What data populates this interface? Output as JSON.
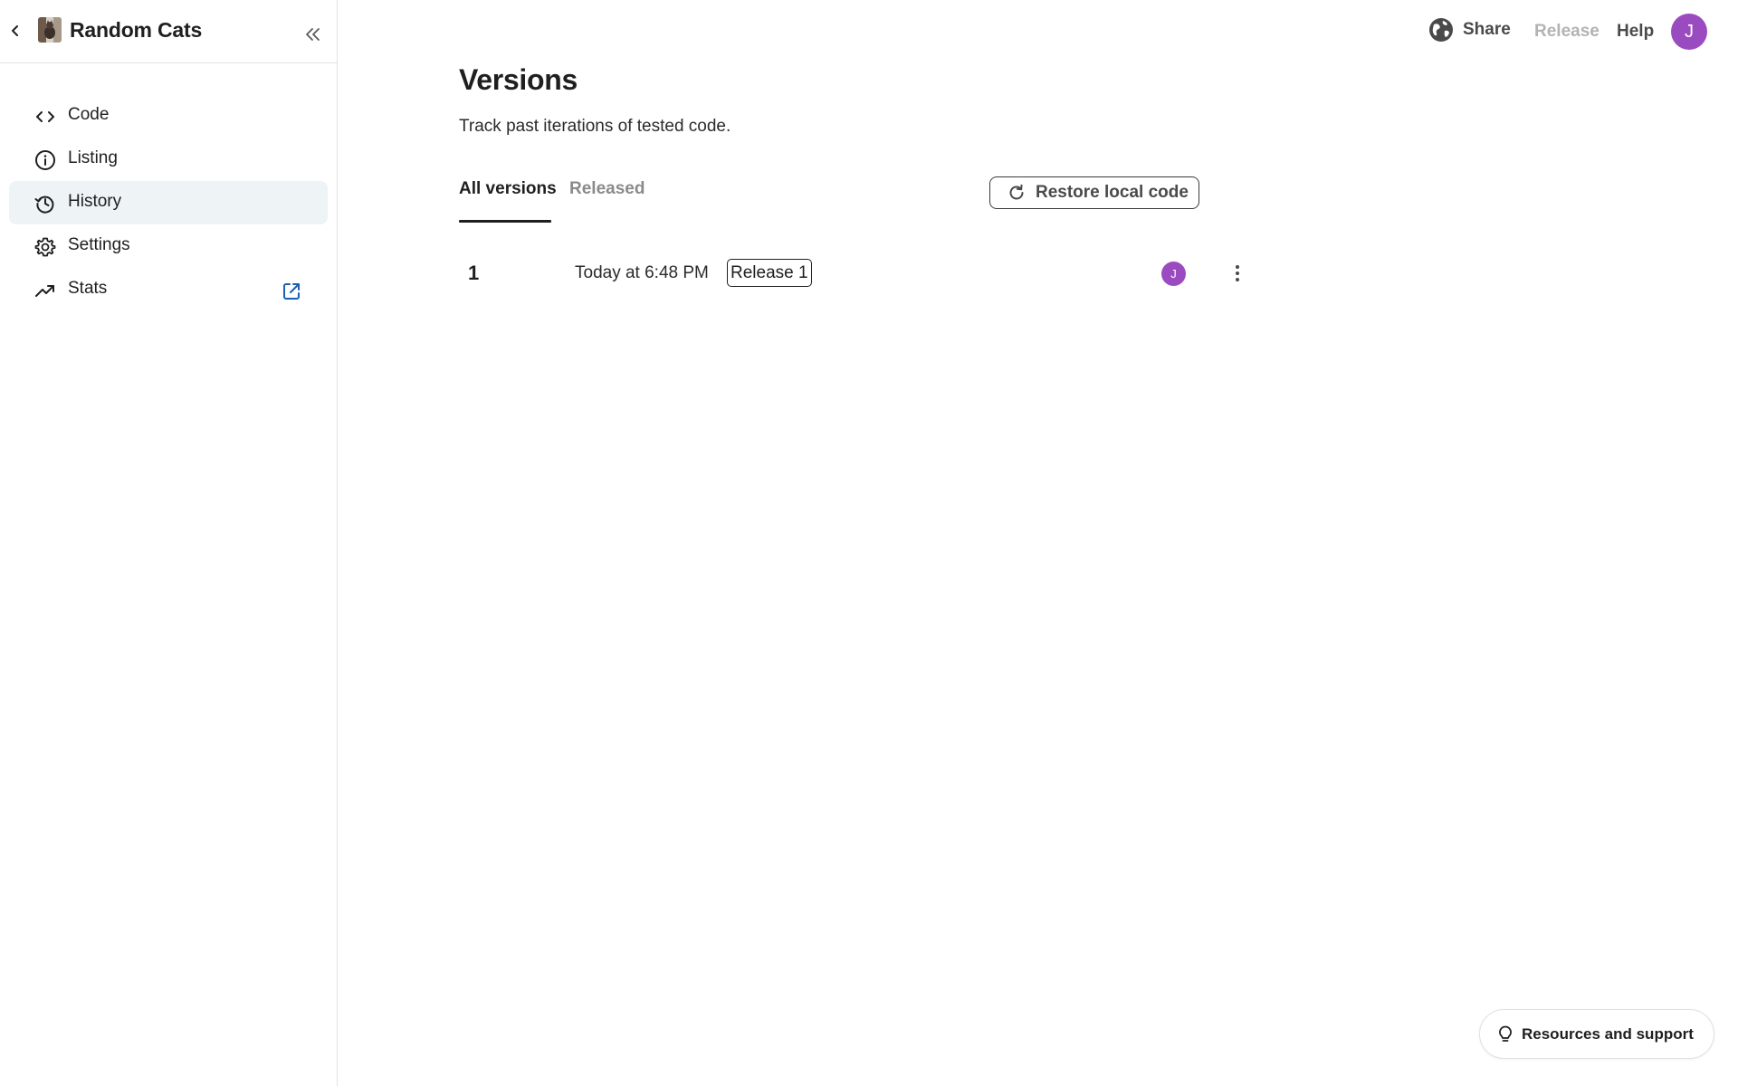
{
  "app": {
    "title": "Random Cats",
    "icon": "cat-photo-icon"
  },
  "sidebar": {
    "items": [
      {
        "label": "Code",
        "icon": "code-icon",
        "active": false
      },
      {
        "label": "Listing",
        "icon": "info-icon",
        "active": false
      },
      {
        "label": "History",
        "icon": "history-icon",
        "active": true
      },
      {
        "label": "Settings",
        "icon": "gear-icon",
        "active": false
      },
      {
        "label": "Stats",
        "icon": "trending-up-icon",
        "active": false,
        "external": "external-link-icon"
      }
    ]
  },
  "header": {
    "share_label": "Share",
    "release_label": "Release",
    "help_label": "Help",
    "avatar_initial": "J"
  },
  "main": {
    "title": "Versions",
    "subtitle": "Track past iterations of tested code.",
    "tabs": [
      {
        "label": "All versions",
        "active": true
      },
      {
        "label": "Released",
        "active": false
      }
    ],
    "restore_label": "Restore local code",
    "versions": [
      {
        "number": "1",
        "time": "Today at 6:48 PM",
        "badge": "Release 1",
        "author_initial": "J"
      }
    ]
  },
  "footer": {
    "resources_label": "Resources and support"
  },
  "colors": {
    "accent_purple": "#9b4bc0",
    "active_nav_bg": "#eef3f6",
    "external_link_blue": "#1a5fb4"
  }
}
